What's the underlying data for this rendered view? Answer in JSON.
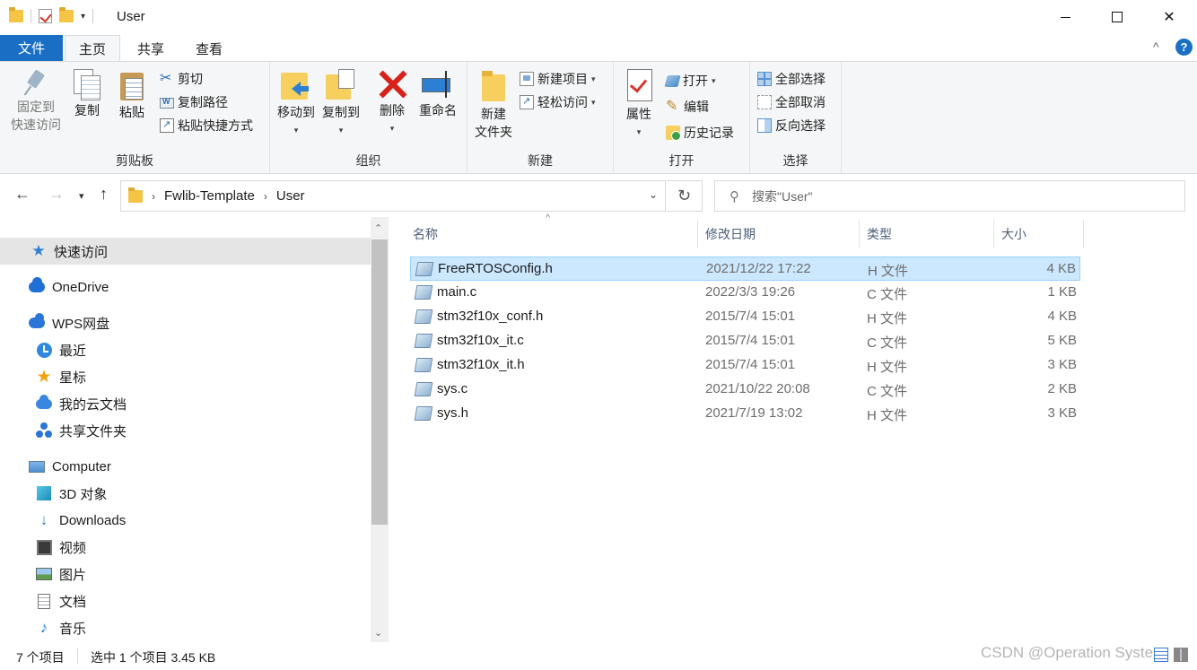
{
  "window": {
    "title": "User",
    "minimize": "—",
    "close": "✕"
  },
  "ribbon_tabs": {
    "file": "文件",
    "home": "主页",
    "share": "共享",
    "view": "查看",
    "collapse": "^",
    "help": "?"
  },
  "ribbon": {
    "clipboard": {
      "label": "剪贴板",
      "pin_line1": "固定到",
      "pin_line2": "快速访问",
      "copy": "复制",
      "paste": "粘贴",
      "cut": "剪切",
      "copy_path": "复制路径",
      "paste_shortcut": "粘贴快捷方式"
    },
    "organize": {
      "label": "组织",
      "move_to": "移动到",
      "copy_to": "复制到",
      "delete": "删除",
      "rename": "重命名"
    },
    "new": {
      "label": "新建",
      "new_folder_line1": "新建",
      "new_folder_line2": "文件夹",
      "new_item": "新建项目",
      "easy_access": "轻松访问"
    },
    "open": {
      "label": "打开",
      "properties": "属性",
      "open": "打开",
      "edit": "编辑",
      "history": "历史记录"
    },
    "select": {
      "label": "选择",
      "select_all": "全部选择",
      "select_none": "全部取消",
      "invert": "反向选择"
    }
  },
  "address": {
    "crumbs": [
      "Fwlib-Template",
      "User"
    ],
    "search_placeholder": "搜索\"User\""
  },
  "nav": {
    "quick_access": "快速访问",
    "onedrive": "OneDrive",
    "wps": "WPS网盘",
    "recent": "最近",
    "starred": "星标",
    "my_cloud": "我的云文档",
    "shared": "共享文件夹",
    "computer": "Computer",
    "objects3d": "3D 对象",
    "downloads": "Downloads",
    "videos": "视频",
    "pictures": "图片",
    "documents": "文档",
    "music": "音乐"
  },
  "columns": {
    "name": "名称",
    "date": "修改日期",
    "type": "类型",
    "size": "大小"
  },
  "files": [
    {
      "name": "FreeRTOSConfig.h",
      "date": "2021/12/22 17:22",
      "type": "H 文件",
      "size": "4 KB"
    },
    {
      "name": "main.c",
      "date": "2022/3/3 19:26",
      "type": "C 文件",
      "size": "1 KB"
    },
    {
      "name": "stm32f10x_conf.h",
      "date": "2015/7/4 15:01",
      "type": "H 文件",
      "size": "4 KB"
    },
    {
      "name": "stm32f10x_it.c",
      "date": "2015/7/4 15:01",
      "type": "C 文件",
      "size": "5 KB"
    },
    {
      "name": "stm32f10x_it.h",
      "date": "2015/7/4 15:01",
      "type": "H 文件",
      "size": "3 KB"
    },
    {
      "name": "sys.c",
      "date": "2021/10/22 20:08",
      "type": "C 文件",
      "size": "2 KB"
    },
    {
      "name": "sys.h",
      "date": "2021/7/19 13:02",
      "type": "H 文件",
      "size": "3 KB"
    }
  ],
  "status": {
    "count": "7 个项目",
    "selection": "选中 1 个项目  3.45 KB",
    "watermark": "CSDN @Operation System"
  },
  "colors": {
    "accent": "#1a6fc5",
    "selection": "#cce8ff",
    "selection_border": "#99d1ff"
  }
}
